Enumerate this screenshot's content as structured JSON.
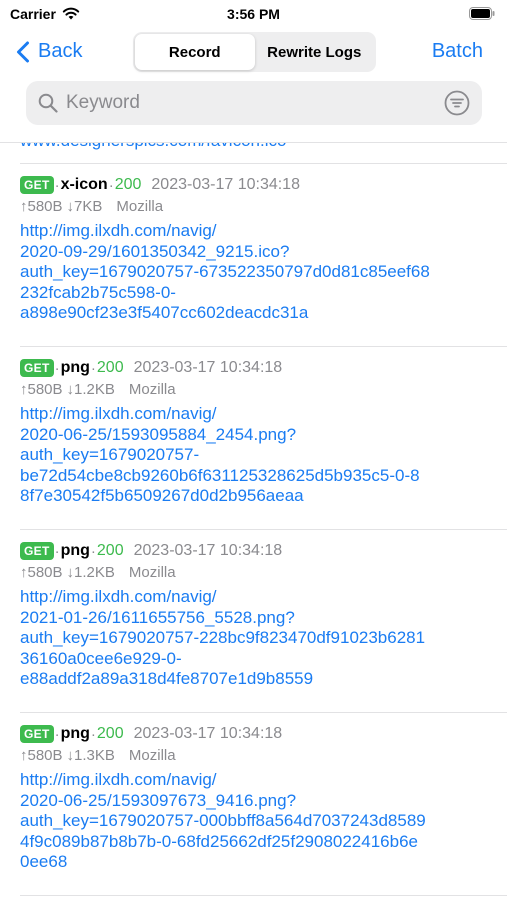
{
  "status_bar": {
    "carrier": "Carrier",
    "time": "3:56 PM"
  },
  "nav": {
    "back_label": "Back",
    "segments": [
      "Record",
      "Rewrite Logs"
    ],
    "active_segment": "Record",
    "batch_label": "Batch"
  },
  "search": {
    "placeholder": "Keyword"
  },
  "colors": {
    "accent": "#1a7cf2",
    "success": "#3dba4e",
    "secondary": "#8a8a8e"
  },
  "partial_url": "www.designerspics.com/favicon.ico",
  "records": [
    {
      "method": "GET",
      "type": "x-icon",
      "status": "200",
      "time": "2023-03-17 10:34:18",
      "up": "↑580B",
      "down": "↓7KB",
      "agent": "Mozilla",
      "url_lines": [
        "http://img.ilxdh.com/navig/",
        "2020-09-29/1601350342_9215.ico?",
        "auth_key=1679020757-673522350797d0d81c85eef68",
        "232fcab2b75c598-0-",
        "a898e90cf23e3f5407cc602deacdc31a"
      ]
    },
    {
      "method": "GET",
      "type": "png",
      "status": "200",
      "time": "2023-03-17 10:34:18",
      "up": "↑580B",
      "down": "↓1.2KB",
      "agent": "Mozilla",
      "url_lines": [
        "http://img.ilxdh.com/navig/",
        "2020-06-25/1593095884_2454.png?",
        "auth_key=1679020757-",
        "be72d54cbe8cb9260b6f631125328625d5b935c5-0-8",
        "8f7e30542f5b6509267d0d2b956aeaa"
      ]
    },
    {
      "method": "GET",
      "type": "png",
      "status": "200",
      "time": "2023-03-17 10:34:18",
      "up": "↑580B",
      "down": "↓1.2KB",
      "agent": "Mozilla",
      "url_lines": [
        "http://img.ilxdh.com/navig/",
        "2021-01-26/1611655756_5528.png?",
        "auth_key=1679020757-228bc9f823470df91023b6281",
        "36160a0cee6e929-0-",
        "e88addf2a89a318d4fe8707e1d9b8559"
      ]
    },
    {
      "method": "GET",
      "type": "png",
      "status": "200",
      "time": "2023-03-17 10:34:18",
      "up": "↑580B",
      "down": "↓1.3KB",
      "agent": "Mozilla",
      "url_lines": [
        "http://img.ilxdh.com/navig/",
        "2020-06-25/1593097673_9416.png?",
        "auth_key=1679020757-000bbff8a564d7037243d8589",
        "4f9c089b87b8b7b-0-68fd25662df25f2908022416b6e",
        "0ee68"
      ]
    }
  ]
}
